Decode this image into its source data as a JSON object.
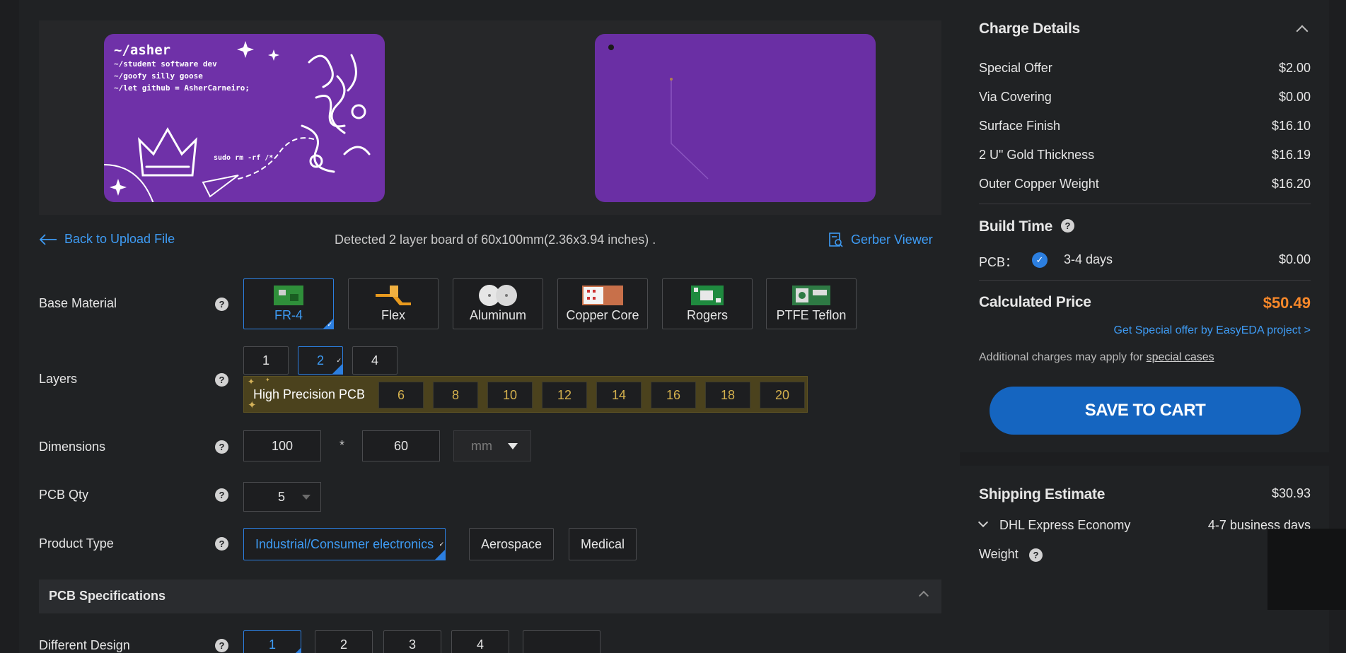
{
  "preview": {
    "code_lines": [
      "~/asher",
      "~/student software dev",
      "~/goofy silly goose",
      "~/let github = AsherCarneiro;"
    ],
    "code_sudo": "sudo rm -rf /*"
  },
  "nav": {
    "back_label": "Back to Upload File",
    "detected_text": "Detected 2 layer board of 60x100mm(2.36x3.94 inches) .",
    "gerber_label": "Gerber Viewer"
  },
  "form": {
    "base_material": {
      "label": "Base Material",
      "options": [
        "FR-4",
        "Flex",
        "Aluminum",
        "Copper Core",
        "Rogers",
        "PTFE Teflon"
      ],
      "selected": "FR-4"
    },
    "layers": {
      "label": "Layers",
      "options": [
        "1",
        "2",
        "4"
      ],
      "selected": "2",
      "high_precision_label": "High Precision PCB",
      "high_precision_options": [
        "6",
        "8",
        "10",
        "12",
        "14",
        "16",
        "18",
        "20"
      ]
    },
    "dimensions": {
      "label": "Dimensions",
      "width": "100",
      "separator": "*",
      "height": "60",
      "unit": "mm"
    },
    "qty": {
      "label": "PCB Qty",
      "value": "5"
    },
    "product_type": {
      "label": "Product Type",
      "options": [
        "Industrial/Consumer electronics",
        "Aerospace",
        "Medical"
      ],
      "selected": "Industrial/Consumer electronics"
    },
    "specs_section": {
      "title": "PCB Specifications"
    },
    "different_design": {
      "label": "Different Design",
      "options": [
        "1",
        "2",
        "3",
        "4"
      ],
      "selected": "1"
    },
    "help_glyph": "?"
  },
  "charges": {
    "title": "Charge Details",
    "items": [
      {
        "label": "Special Offer",
        "value": "$2.00"
      },
      {
        "label": "Via Covering",
        "value": "$0.00"
      },
      {
        "label": "Surface Finish",
        "value": "$16.10"
      },
      {
        "label": "2 U\" Gold Thickness",
        "value": "$16.19"
      },
      {
        "label": "Outer Copper Weight",
        "value": "$16.20"
      }
    ],
    "build_time_title": "Build Time",
    "pcb_label": "PCB：",
    "pcb_time": "3-4 days",
    "pcb_time_price": "$0.00",
    "calculated_label": "Calculated Price",
    "calculated_value": "$50.49",
    "special_link": "Get Special offer by EasyEDA project >",
    "additional_prefix": "Additional charges may apply for ",
    "additional_link": "special cases",
    "save_button": "SAVE TO CART"
  },
  "shipping": {
    "title": "Shipping Estimate",
    "price": "$30.93",
    "method": "DHL Express Economy",
    "eta": "4-7 business days",
    "weight_label": "Weight"
  },
  "colors": {
    "accent": "#2c7fe0",
    "link": "#3e9cf5",
    "price": "#f7882a",
    "board": "#6f31a8"
  }
}
